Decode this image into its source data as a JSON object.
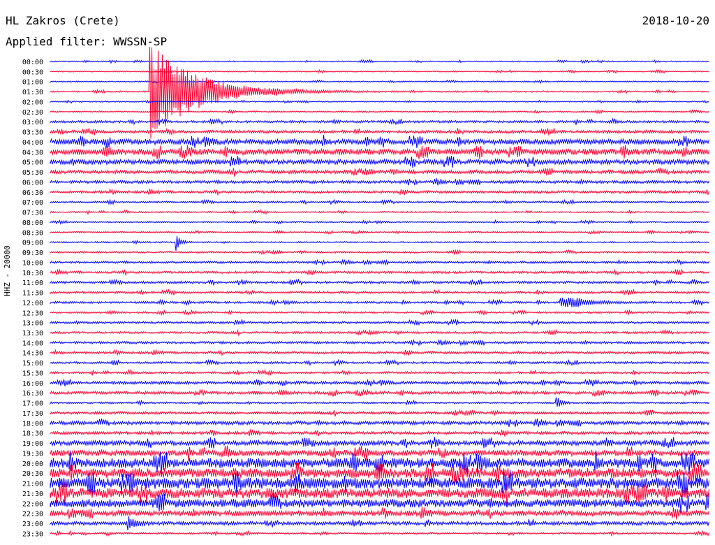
{
  "header": {
    "station": "HL Zakros (Crete)",
    "date": "2018-10-20",
    "filter": "Applied filter: WWSSN-SP"
  },
  "chart_data": {
    "type": "line",
    "title": "HL Zakros (Crete)",
    "channel_label": "HHZ - 20000",
    "colors": [
      "#0000ff",
      "#ff0033"
    ],
    "row_labels": [
      "00:00",
      "00:30",
      "01:00",
      "01:30",
      "02:00",
      "02:30",
      "03:00",
      "03:30",
      "04:00",
      "04:30",
      "05:00",
      "05:30",
      "06:00",
      "06:30",
      "07:00",
      "07:30",
      "08:00",
      "08:30",
      "09:00",
      "09:30",
      "10:00",
      "10:30",
      "11:00",
      "11:30",
      "12:00",
      "12:30",
      "13:00",
      "13:30",
      "14:00",
      "14:30",
      "15:00",
      "15:30",
      "16:00",
      "16:30",
      "17:00",
      "17:30",
      "18:00",
      "18:30",
      "19:00",
      "19:30",
      "20:00",
      "20:30",
      "21:00",
      "21:30",
      "22:00",
      "22:30",
      "23:00",
      "23:30"
    ],
    "noise_level": [
      0.1,
      0.1,
      0.1,
      0.12,
      0.1,
      0.12,
      0.2,
      0.25,
      0.45,
      0.5,
      0.4,
      0.3,
      0.25,
      0.22,
      0.15,
      0.12,
      0.12,
      0.12,
      0.12,
      0.15,
      0.18,
      0.2,
      0.2,
      0.18,
      0.18,
      0.15,
      0.18,
      0.18,
      0.2,
      0.2,
      0.18,
      0.18,
      0.25,
      0.25,
      0.15,
      0.22,
      0.3,
      0.25,
      0.4,
      0.5,
      0.8,
      0.8,
      0.9,
      0.85,
      0.7,
      0.45,
      0.3,
      0.15
    ],
    "events": [
      {
        "row": 3,
        "time_min": 4.5,
        "amp": 5.0,
        "decay_min": 2.0
      },
      {
        "row": 18,
        "time_min": 5.7,
        "amp": 0.9,
        "decay_min": 0.2
      },
      {
        "row": 24,
        "time_min": 23.2,
        "amp": 0.6,
        "decay_min": 1.0
      },
      {
        "row": 34,
        "time_min": 23.0,
        "amp": 0.8,
        "decay_min": 0.2
      },
      {
        "row": 46,
        "time_min": 3.5,
        "amp": 0.8,
        "decay_min": 0.3
      }
    ]
  }
}
